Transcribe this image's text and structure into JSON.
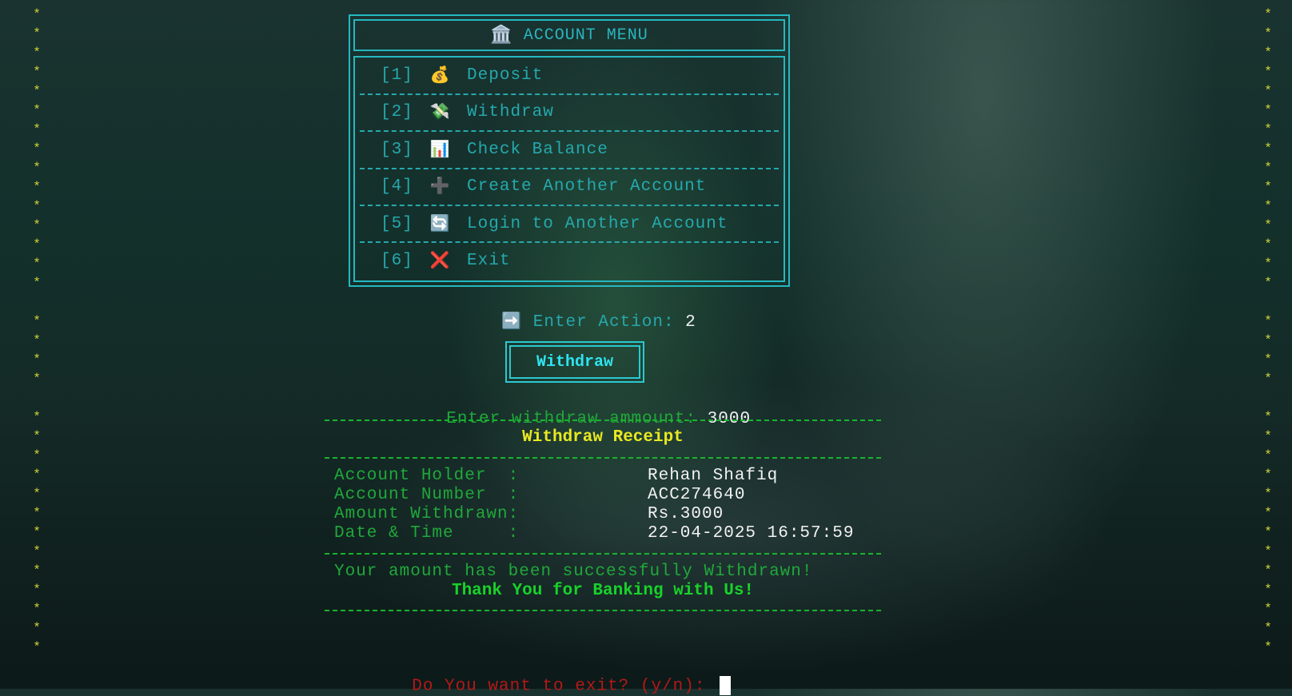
{
  "menu": {
    "title_icon": "🏛️",
    "title": "ACCOUNT MENU",
    "items": [
      {
        "key": "[1]",
        "emoji": "💰",
        "icon_name": "money-bag-icon",
        "label": "Deposit"
      },
      {
        "key": "[2]",
        "emoji": "💸",
        "icon_name": "money-wings-icon",
        "label": "Withdraw"
      },
      {
        "key": "[3]",
        "emoji": "📊",
        "icon_name": "bar-chart-icon",
        "label": "Check Balance"
      },
      {
        "key": "[4]",
        "emoji": "➕",
        "icon_name": "plus-icon",
        "label": "Create Another Account"
      },
      {
        "key": "[5]",
        "emoji": "🔄",
        "icon_name": "refresh-icon",
        "label": "Login to Another Account"
      },
      {
        "key": "[6]",
        "emoji": "❌",
        "icon_name": "cross-icon",
        "label": "Exit"
      }
    ]
  },
  "action_prompt": {
    "emoji": "➡️",
    "label": "Enter Action: ",
    "value": "2"
  },
  "section_title": "Withdraw",
  "withdraw_prompt": {
    "label": "Enter withdraw ammount: ",
    "value": "3000"
  },
  "receipt": {
    "title": "Withdraw Receipt",
    "rows": [
      {
        "label": "Account Holder  :",
        "value": "Rehan Shafiq"
      },
      {
        "label": "Account Number  :",
        "value": "ACC274640"
      },
      {
        "label": "Amount Withdrawn:",
        "value": "Rs.3000"
      },
      {
        "label": "Date & Time     :",
        "value": "22-04-2025 16:57:59"
      }
    ],
    "success_message": "Your amount has been successfully Withdrawn!",
    "thanks_message": "Thank You for Banking with Us!"
  },
  "exit_prompt": "Do You want to exit? (y/n): ",
  "decoration": {
    "star": "*"
  },
  "colors": {
    "cyan": "#25b8bf",
    "green": "#20a83a",
    "yellow": "#e8e821",
    "red": "#b41818",
    "star": "#d8d838"
  }
}
